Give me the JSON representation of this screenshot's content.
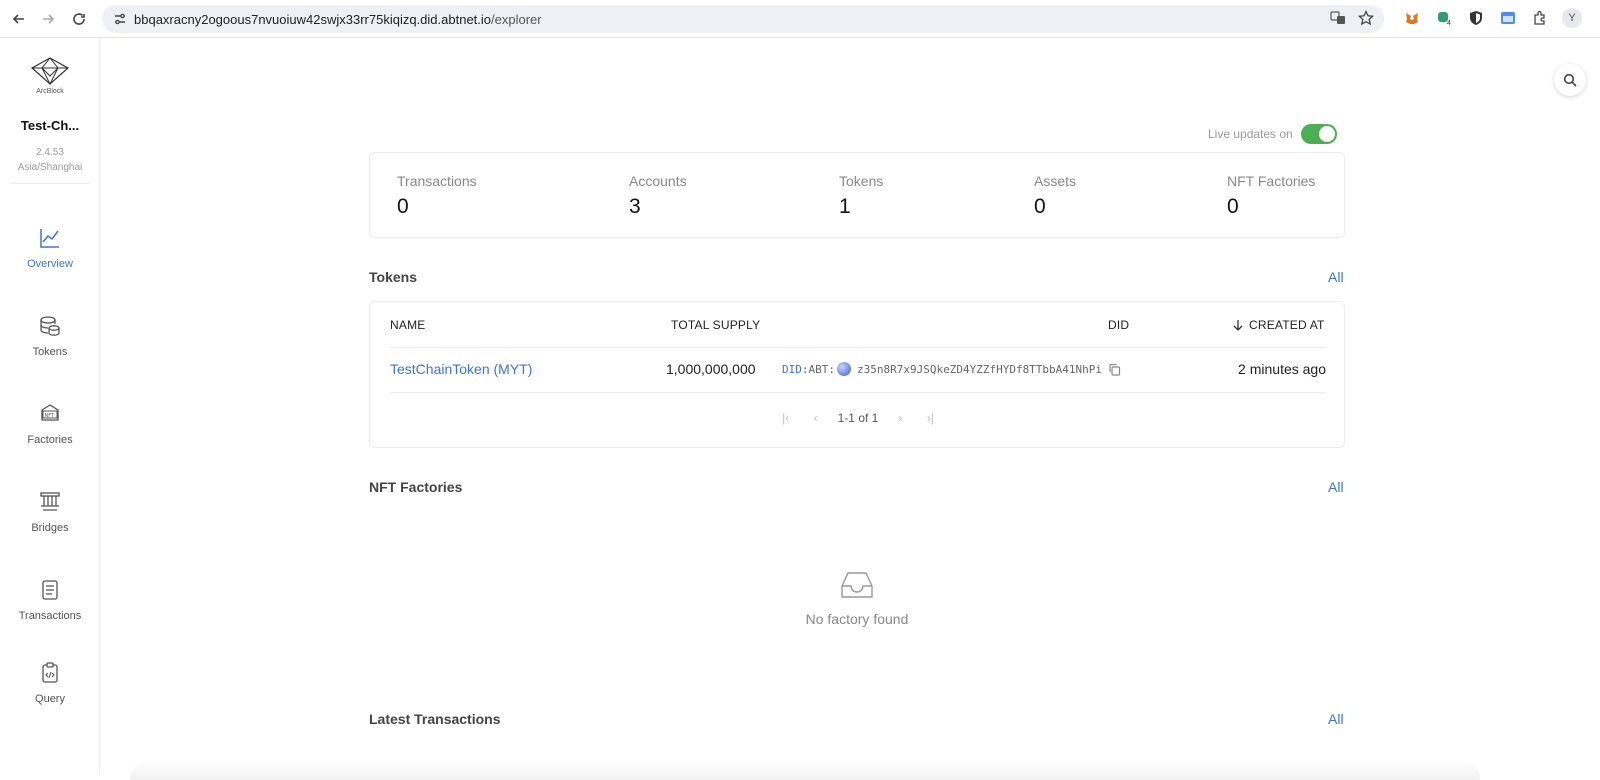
{
  "browser": {
    "url_host": "bbqaxracny2ogoous7nvuoiuw42swjx33rr75kiqizq.did.abtnet.io",
    "url_path": "/explorer",
    "profile_initial": "Y"
  },
  "sidebar": {
    "logo_text": "ArcBlock",
    "chain_name": "Test-Ch...",
    "version": "2.4.53",
    "timezone": "Asia/Shanghai",
    "items": [
      {
        "label": "Overview",
        "icon": "chart-line-icon",
        "active": true
      },
      {
        "label": "Tokens",
        "icon": "coins-stack-icon",
        "active": false
      },
      {
        "label": "Factories",
        "icon": "nft-icon",
        "active": false
      },
      {
        "label": "Bridges",
        "icon": "bridge-icon",
        "active": false
      },
      {
        "label": "Transactions",
        "icon": "document-icon",
        "active": false
      },
      {
        "label": "Query",
        "icon": "clipboard-code-icon",
        "active": false
      }
    ]
  },
  "live_updates": {
    "label": "Live updates on",
    "enabled": true
  },
  "stats": [
    {
      "label": "Transactions",
      "value": "0"
    },
    {
      "label": "Accounts",
      "value": "3"
    },
    {
      "label": "Tokens",
      "value": "1"
    },
    {
      "label": "Assets",
      "value": "0"
    },
    {
      "label": "NFT Factories",
      "value": "0"
    }
  ],
  "tokens_section": {
    "title": "Tokens",
    "all_label": "All",
    "columns": {
      "name": "NAME",
      "total_supply": "TOTAL SUPPLY",
      "did": "DID",
      "created_at": "CREATED AT"
    },
    "rows": [
      {
        "name": "TestChainToken (MYT)",
        "total_supply": "1,000,000,000",
        "did_prefix": "DID",
        "did_method": ":ABT:",
        "did_address": "z35n8R7x9JSQkeZD4YZZfHYDf8TTbbA41NhPi",
        "created_at": "2 minutes ago"
      }
    ],
    "pagination": "1-1 of 1"
  },
  "nft_section": {
    "title": "NFT Factories",
    "all_label": "All",
    "empty_message": "No factory found"
  },
  "transactions_section": {
    "title": "Latest Transactions",
    "all_label": "All"
  },
  "colors": {
    "accent": "#3b74d8",
    "toggle_on": "#4caf50"
  }
}
